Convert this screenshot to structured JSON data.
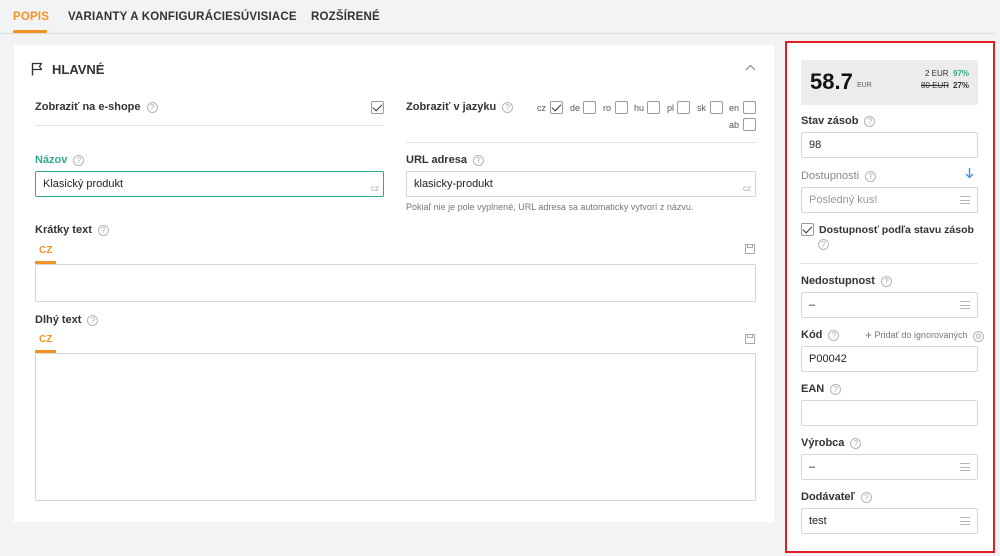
{
  "tabs": [
    {
      "label": "POPIS"
    },
    {
      "label": "VARIANTY A KONFIGURÁCIE"
    },
    {
      "label": "SÚVISIACE"
    },
    {
      "label": "ROZŠÍRENÉ"
    }
  ],
  "section": {
    "title": "HLAVNÉ"
  },
  "form": {
    "show_eshop_label": "Zobraziť na e-shope",
    "show_lang_label": "Zobraziť v jazyku",
    "languages": [
      {
        "code": "cz",
        "checked": true
      },
      {
        "code": "de",
        "checked": false
      },
      {
        "code": "ro",
        "checked": false
      },
      {
        "code": "hu",
        "checked": false
      },
      {
        "code": "pl",
        "checked": false
      },
      {
        "code": "sk",
        "checked": false
      },
      {
        "code": "en",
        "checked": false
      },
      {
        "code": "ab",
        "checked": false
      }
    ],
    "name_label": "Názov",
    "name_value": "Klasický produkt",
    "name_lang": "cz",
    "url_label": "URL adresa",
    "url_value": "klasicky-produkt",
    "url_lang": "cz",
    "url_hint": "Pokiaľ nie je pole vyplnené, URL adresa sa automaticky vytvorí z názvu.",
    "short_text_label": "Krátky text",
    "short_text_tab": "CZ",
    "long_text_label": "Dlhý text",
    "long_text_tab": "CZ"
  },
  "sidebar": {
    "price": "58.7",
    "currency": "EUR",
    "price_line1": "2 EUR",
    "price_line1_pct": "97%",
    "price_line2": "80 EUR",
    "price_line2_pct": "27%",
    "stock_label": "Stav zásob",
    "stock_value": "98",
    "availability_label": "Dostupnosti",
    "availability_placeholder": "Posledný kus!",
    "availability_by_stock_label": "Dostupnosť podľa stavu zásob",
    "unavailability_label": "Nedostupnost",
    "unavailability_value": "–",
    "code_label": "Kód",
    "code_add_ignored": "Pridať do ignorovaných",
    "code_value": "P00042",
    "ean_label": "EAN",
    "ean_value": "",
    "manufacturer_label": "Výrobca",
    "manufacturer_value": "–",
    "supplier_label": "Dodávateľ",
    "supplier_value": "test"
  },
  "colors": {
    "accent": "#f29423",
    "focus": "#31a88c",
    "highlight": "#e31d24",
    "link": "#3b8fd9"
  }
}
